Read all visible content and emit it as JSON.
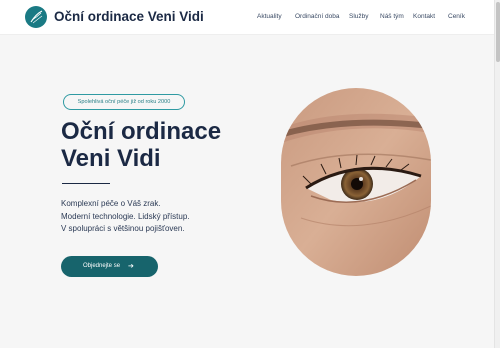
{
  "header": {
    "brand": "Oční ordinace Veni Vidi",
    "logo_icon": "eye-leaf-logo-icon",
    "nav": [
      {
        "label": "Aktuality"
      },
      {
        "label": "Ordinační doba"
      },
      {
        "label": "Služby"
      },
      {
        "label": "Náš tým"
      },
      {
        "label": "Kontakt"
      },
      {
        "label": "Ceník"
      }
    ]
  },
  "hero": {
    "badge": "Spolehlivá oční péče již od roku 2000",
    "title_line1": "Oční ordinace",
    "title_line2": "Veni Vidi",
    "desc_line1": "Komplexní péče o Váš zrak.",
    "desc_line2": "Moderní technologie. Lidský přístup.",
    "desc_line3": "V spolupráci s většinou pojišťoven.",
    "cta_label": "Objednejte se",
    "cta_icon": "arrow-right-icon",
    "image": "eye-closeup-photo"
  },
  "colors": {
    "accent": "#1a7a84",
    "cta": "#17646c",
    "text": "#1b2944",
    "background": "#f6f6f6"
  }
}
